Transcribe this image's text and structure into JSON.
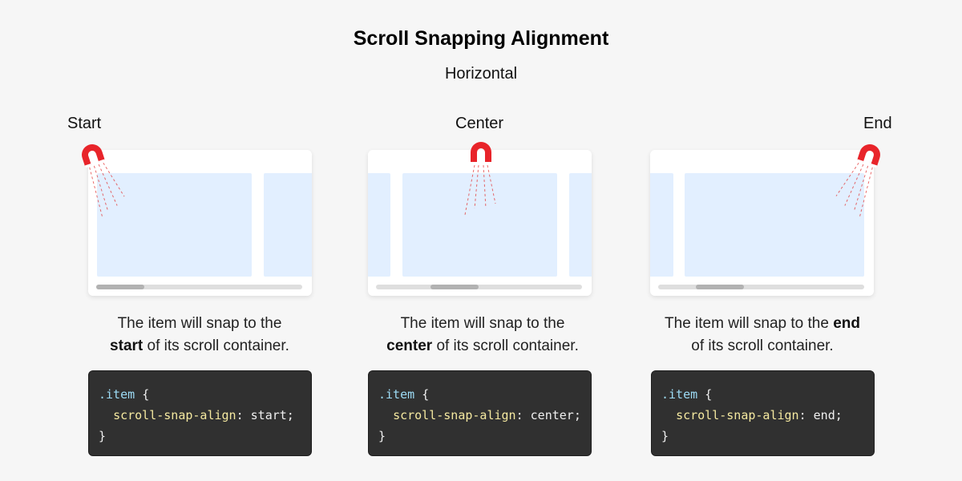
{
  "title": "Scroll Snapping Alignment",
  "subtitle": "Horizontal",
  "columns": [
    {
      "label": "Start",
      "desc_before": "The item will snap to the",
      "desc_bold": "start",
      "desc_after": "of its scroll container.",
      "code": {
        "selector": ".item",
        "open": "{",
        "property": "scroll-snap-align",
        "colon": ":",
        "value": "start;",
        "close": "}"
      }
    },
    {
      "label": "Center",
      "desc_before": "The item will snap to the",
      "desc_bold": "center",
      "desc_after": "of its scroll container.",
      "code": {
        "selector": ".item",
        "open": "{",
        "property": "scroll-snap-align",
        "colon": ":",
        "value": "center;",
        "close": "}"
      }
    },
    {
      "label": "End",
      "desc_before": "The item will snap to the",
      "desc_bold": "end",
      "desc_after": "of its scroll container.",
      "code": {
        "selector": ".item",
        "open": "{",
        "property": "scroll-snap-align",
        "colon": ":",
        "value": "end;",
        "close": "}"
      }
    }
  ],
  "colors": {
    "background": "#f6f6f6",
    "item": "#e2efff",
    "magnet": "#e8242a",
    "code_bg": "#303030",
    "selector": "#9ddbf5",
    "property": "#f5e9a0"
  },
  "icons": [
    "magnet-icon"
  ]
}
